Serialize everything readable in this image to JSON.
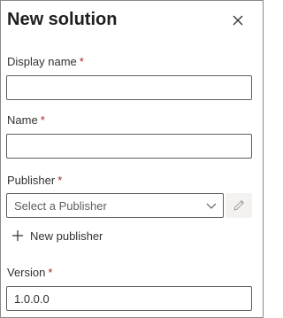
{
  "panel": {
    "title": "New solution"
  },
  "icons": {
    "close": "close-icon",
    "chevron": "chevron-down-icon",
    "edit": "pencil-icon",
    "add": "plus-icon"
  },
  "fields": {
    "display_name": {
      "label": "Display name",
      "required": "*",
      "value": ""
    },
    "name": {
      "label": "Name",
      "required": "*",
      "value": ""
    },
    "publisher": {
      "label": "Publisher",
      "required": "*",
      "placeholder": "Select a Publisher",
      "new_label": "New publisher"
    },
    "version": {
      "label": "Version",
      "required": "*",
      "value": "1.0.0.0"
    }
  },
  "colors": {
    "required": "#a4262c",
    "border": "#605e5c",
    "disabled_button": "#f3f2f1"
  }
}
